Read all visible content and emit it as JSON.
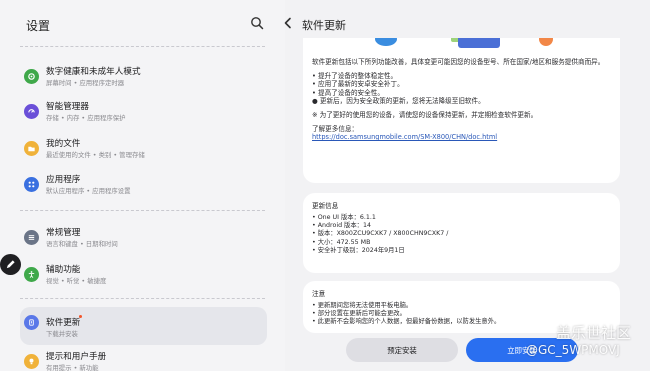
{
  "left": {
    "title": "设置",
    "items": [
      {
        "title": "数字健康和未成年人模式",
        "subtitle": "屏幕时间 • 应用程序定时器",
        "icon": "digital-wellbeing-icon",
        "color": "#3fa84a"
      },
      {
        "title": "智能管理器",
        "subtitle": "存储 • 内存 • 应用程序保护",
        "icon": "device-care-icon",
        "color": "#6a4fd8"
      },
      {
        "title": "我的文件",
        "subtitle": "最近使用的文件 • 类别 • 管理存储",
        "icon": "folder-icon",
        "color": "#f0b23a"
      },
      {
        "title": "应用程序",
        "subtitle": "默认应用程序 • 应用程序设置",
        "icon": "apps-icon",
        "color": "#3a70e0"
      },
      {
        "title": "常规管理",
        "subtitle": "语言和键盘 • 日期和时间",
        "icon": "general-management-icon",
        "color": "#6a7487"
      },
      {
        "title": "辅助功能",
        "subtitle": "视觉 • 听觉 • 敏捷度",
        "icon": "accessibility-icon",
        "color": "#3fa84a"
      },
      {
        "title": "软件更新",
        "subtitle": "下载并安装",
        "icon": "software-update-icon",
        "color": "#5a78e8"
      },
      {
        "title": "提示和用户手册",
        "subtitle": "有用提示 • 新功能",
        "icon": "tips-icon",
        "color": "#f0b23a"
      }
    ]
  },
  "right": {
    "title": "软件更新",
    "description": {
      "intro": "软件更新包括以下所列功能改善，具体变更可能因您的设备型号、所在国家/地区和服务提供商而异。",
      "bullets": [
        "• 提升了设备的整体稳定性。",
        "• 应用了最新的安卓安全补丁。",
        "• 提高了设备的安全性。"
      ],
      "warning": "● 更新后，因为安全政策的更新，您将无法降级至旧软件。",
      "recommend": "※ 为了更好的使用您的设备，请使您的设备保持更新，并定期检查软件更新。",
      "more_label": "了解更多信息：",
      "link": "https://doc.samsungmobile.com/SM-X800/CHN/doc.html"
    },
    "info": {
      "heading": "更新信息",
      "lines": [
        "• One UI 版本：6.1.1",
        "• Android 版本：14",
        "• 版本：X800ZCU9CXK7 / X800CHN9CXK7 /",
        "• 大小：472.55 MB",
        "• 安全补丁级别：2024年9月1日"
      ]
    },
    "notes": {
      "heading": "注意",
      "lines": [
        "• 更新期间您将无法使用平板电脑。",
        "• 部分设置在更新后可能会更改。",
        "• 此更新不会影响您的个人数据，但最好备份数据，以防发生意外。"
      ]
    },
    "buttons": {
      "schedule": "预定安装",
      "install": "立即安装"
    }
  },
  "watermark": {
    "line1": "盖乐世社区",
    "line2": "@GC_5WPMOVJ"
  }
}
